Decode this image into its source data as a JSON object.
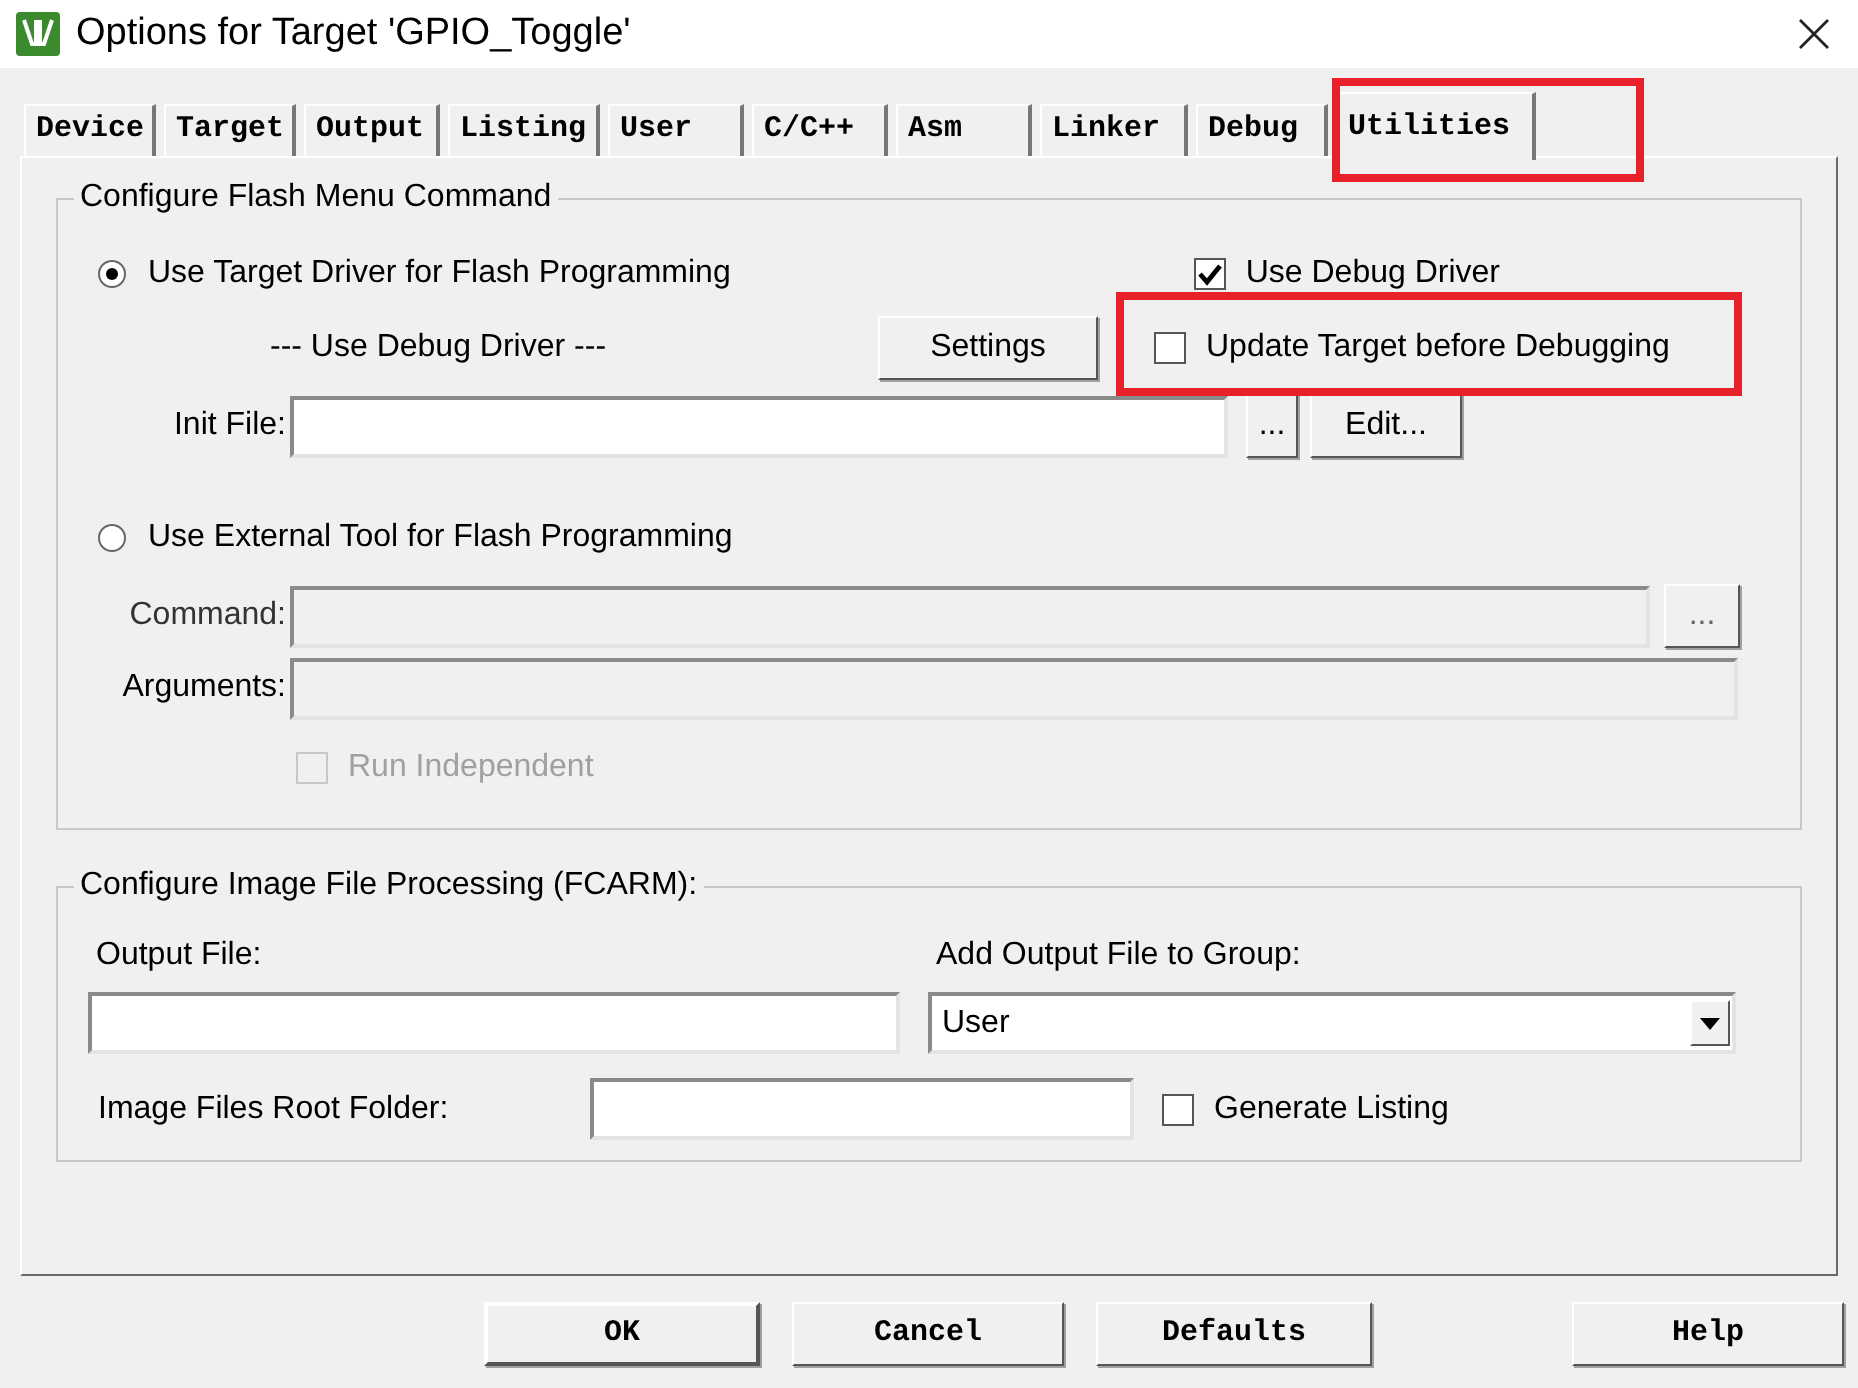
{
  "window": {
    "title": "Options for Target 'GPIO_Toggle'"
  },
  "tabs": [
    {
      "label": "Device",
      "selected": false,
      "highlighted": false
    },
    {
      "label": "Target",
      "selected": false,
      "highlighted": false
    },
    {
      "label": "Output",
      "selected": false,
      "highlighted": false
    },
    {
      "label": "Listing",
      "selected": false,
      "highlighted": false
    },
    {
      "label": "User",
      "selected": false,
      "highlighted": false
    },
    {
      "label": "C/C++",
      "selected": false,
      "highlighted": false
    },
    {
      "label": "Asm",
      "selected": false,
      "highlighted": false
    },
    {
      "label": "Linker",
      "selected": false,
      "highlighted": false
    },
    {
      "label": "Debug",
      "selected": false,
      "highlighted": false
    },
    {
      "label": "Utilities",
      "selected": true,
      "highlighted": true
    }
  ],
  "flash_group": {
    "title": "Configure Flash Menu Command",
    "target_driver": {
      "label": "Use Target Driver for Flash Programming",
      "selected": true
    },
    "use_debug_driver": {
      "label": "Use Debug Driver",
      "checked": true
    },
    "driver_note": "--- Use Debug Driver ---",
    "settings_button": "Settings",
    "update_target": {
      "label": "Update Target before Debugging",
      "checked": false,
      "highlighted": true
    },
    "init_file": {
      "label": "Init File:",
      "browse": "...",
      "edit": "Edit..."
    },
    "external_tool": {
      "label": "Use External Tool for Flash Programming",
      "selected": false
    },
    "command": {
      "label": "Command:",
      "browse": "...",
      "disabled": true
    },
    "arguments": {
      "label": "Arguments:",
      "disabled": true
    },
    "run_independent": {
      "label": "Run Independent",
      "checked": false,
      "disabled": true
    }
  },
  "image_group": {
    "title": "Configure Image File Processing (FCARM):",
    "output_file": {
      "label": "Output File:"
    },
    "add_to_group": {
      "label": "Add Output File  to Group:",
      "value": "User"
    },
    "root_folder": {
      "label": "Image Files Root Folder:"
    },
    "generate_listing": {
      "label": "Generate Listing",
      "checked": false
    }
  },
  "buttons": [
    "OK",
    "Cancel",
    "Defaults",
    "Help"
  ]
}
